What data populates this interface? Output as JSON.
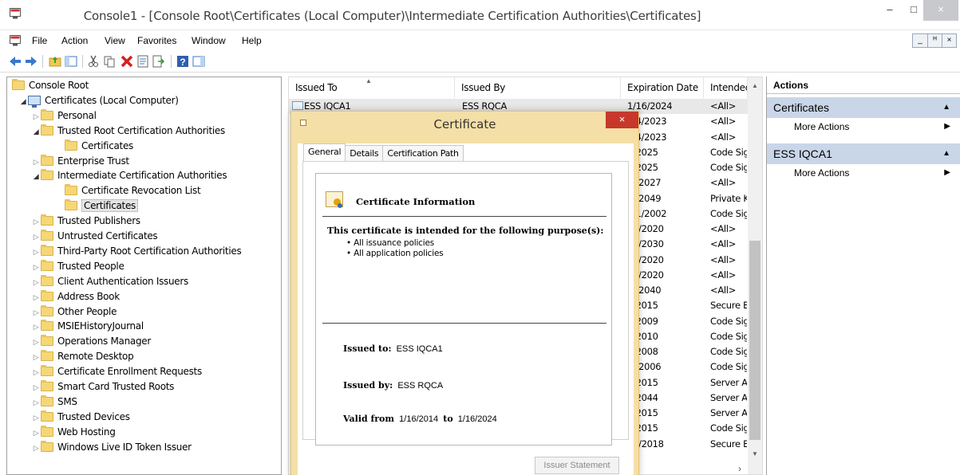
{
  "window": {
    "title": "Console1 - [Console Root\\Certificates (Local Computer)\\Intermediate Certification Authorities\\Certificates]",
    "min_glyph": "–",
    "max_glyph": "□",
    "close_glyph": "×"
  },
  "menu": {
    "items": [
      "File",
      "Action",
      "View",
      "Favorites",
      "Window",
      "Help"
    ],
    "mdi": [
      "_",
      "ᴴ",
      "×"
    ]
  },
  "tree": [
    {
      "label": "Console Root",
      "level": 0,
      "expander": "",
      "icon": "folder"
    },
    {
      "label": "Certificates (Local Computer)",
      "level": 1,
      "expander": "◢",
      "icon": "computer"
    },
    {
      "label": "Personal",
      "level": 2,
      "expander": "▷",
      "icon": "folder"
    },
    {
      "label": "Trusted Root Certification Authorities",
      "level": 2,
      "expander": "◢",
      "icon": "folder"
    },
    {
      "label": "Certificates",
      "level": 3,
      "expander": "",
      "icon": "folder"
    },
    {
      "label": "Enterprise Trust",
      "level": 2,
      "expander": "▷",
      "icon": "folder"
    },
    {
      "label": "Intermediate Certification Authorities",
      "level": 2,
      "expander": "◢",
      "icon": "folder"
    },
    {
      "label": "Certificate Revocation List",
      "level": 3,
      "expander": "",
      "icon": "folder"
    },
    {
      "label": "Certificates",
      "level": 3,
      "expander": "",
      "icon": "folder",
      "selected": true
    },
    {
      "label": "Trusted Publishers",
      "level": 2,
      "expander": "▷",
      "icon": "folder"
    },
    {
      "label": "Untrusted Certificates",
      "level": 2,
      "expander": "▷",
      "icon": "folder"
    },
    {
      "label": "Third-Party Root Certification Authorities",
      "level": 2,
      "expander": "▷",
      "icon": "folder"
    },
    {
      "label": "Trusted People",
      "level": 2,
      "expander": "▷",
      "icon": "folder"
    },
    {
      "label": "Client Authentication Issuers",
      "level": 2,
      "expander": "▷",
      "icon": "folder"
    },
    {
      "label": "Address Book",
      "level": 2,
      "expander": "▷",
      "icon": "folder"
    },
    {
      "label": "Other People",
      "level": 2,
      "expander": "▷",
      "icon": "folder"
    },
    {
      "label": "MSIEHistoryJournal",
      "level": 2,
      "expander": "▷",
      "icon": "folder"
    },
    {
      "label": "Operations Manager",
      "level": 2,
      "expander": "▷",
      "icon": "folder"
    },
    {
      "label": "Remote Desktop",
      "level": 2,
      "expander": "▷",
      "icon": "folder"
    },
    {
      "label": "Certificate Enrollment Requests",
      "level": 2,
      "expander": "▷",
      "icon": "folder"
    },
    {
      "label": "Smart Card Trusted Roots",
      "level": 2,
      "expander": "▷",
      "icon": "folder"
    },
    {
      "label": "SMS",
      "level": 2,
      "expander": "▷",
      "icon": "folder"
    },
    {
      "label": "Trusted Devices",
      "level": 2,
      "expander": "▷",
      "icon": "folder"
    },
    {
      "label": "Web Hosting",
      "level": 2,
      "expander": "▷",
      "icon": "folder"
    },
    {
      "label": "Windows Live ID Token Issuer",
      "level": 2,
      "expander": "▷",
      "icon": "folder"
    }
  ],
  "list": {
    "columns": [
      "Issued To",
      "Issued By",
      "Expiration Date",
      "Intendec"
    ],
    "sort_glyph": "▲",
    "scroll_up": "▲",
    "scroll_down": "▼",
    "h_scroll_glyph": "›",
    "rows": [
      {
        "issued_to": "ESS IQCA1",
        "issued_by": "ESS RQCA",
        "exp": "1/16/2024",
        "purpose": "<All>"
      },
      {
        "issued_to": "",
        "issued_by": "",
        "exp": "/14/2023",
        "purpose": "<All>"
      },
      {
        "issued_to": "",
        "issued_by": "",
        "exp": "/14/2023",
        "purpose": "<All>"
      },
      {
        "issued_to": "",
        "issued_by": "",
        "exp": "3/2025",
        "purpose": "Code Sig"
      },
      {
        "issued_to": "",
        "issued_by": "",
        "exp": "3/2025",
        "purpose": "Code Sig"
      },
      {
        "issued_to": "",
        "issued_by": "",
        "exp": "/5/2027",
        "purpose": "<All>"
      },
      {
        "issued_to": "",
        "issued_by": "",
        "exp": "/1/2049",
        "purpose": "Private K"
      },
      {
        "issued_to": "",
        "issued_by": "",
        "exp": "/31/2002",
        "purpose": "Code Sig"
      },
      {
        "issued_to": "",
        "issued_by": "",
        "exp": "27/2020",
        "purpose": "<All>"
      },
      {
        "issued_to": "",
        "issued_by": "",
        "exp": "27/2030",
        "purpose": "<All>"
      },
      {
        "issued_to": "",
        "issued_by": "",
        "exp": "27/2020",
        "purpose": "<All>"
      },
      {
        "issued_to": "",
        "issued_by": "",
        "exp": "27/2020",
        "purpose": "<All>"
      },
      {
        "issued_to": "",
        "issued_by": "",
        "exp": "/1/2040",
        "purpose": "<All>"
      },
      {
        "issued_to": "",
        "issued_by": "",
        "exp": "3/2015",
        "purpose": "Secure E"
      },
      {
        "issued_to": "",
        "issued_by": "",
        "exp": "3/2009",
        "purpose": "Code Sig"
      },
      {
        "issued_to": "",
        "issued_by": "",
        "exp": "3/2010",
        "purpose": "Code Sig"
      },
      {
        "issued_to": "",
        "issued_by": "",
        "exp": "2/2008",
        "purpose": "Code Sig"
      },
      {
        "issued_to": "",
        "issued_by": "",
        "exp": "/6/2006",
        "purpose": "Code Sig"
      },
      {
        "issued_to": "",
        "issued_by": "",
        "exp": "5/2015",
        "purpose": "Server A"
      },
      {
        "issued_to": "",
        "issued_by": "",
        "exp": "5/2044",
        "purpose": "Server A"
      },
      {
        "issued_to": "",
        "issued_by": "",
        "exp": "5/2015",
        "purpose": "Server A"
      },
      {
        "issued_to": "",
        "issued_by": "",
        "exp": "5/2015",
        "purpose": "Code Sig"
      },
      {
        "issued_to": "",
        "issued_by": "",
        "exp": "20/2018",
        "purpose": "Secure E"
      }
    ]
  },
  "actions": {
    "header": "Actions",
    "sections": [
      {
        "title": "Certificates",
        "collapse_glyph": "▲",
        "items": [
          {
            "label": "More Actions",
            "glyph": "▶"
          }
        ]
      },
      {
        "title": "ESS IQCA1",
        "collapse_glyph": "▲",
        "items": [
          {
            "label": "More Actions",
            "glyph": "▶"
          }
        ]
      }
    ]
  },
  "dialog": {
    "title": "Certificate",
    "close_glyph": "×",
    "tabs": [
      "General",
      "Details",
      "Certification Path"
    ],
    "info_title": "Certificate Information",
    "purpose_heading": "This certificate is intended for the following purpose(s):",
    "policies": [
      "• All issuance policies",
      "• All application policies"
    ],
    "issued_to_label": "Issued to:",
    "issued_to_value": "ESS IQCA1",
    "issued_by_label": "Issued by:",
    "issued_by_value": "ESS RQCA",
    "valid_from_label": "Valid from",
    "valid_from": "1/16/2014",
    "valid_to_label": "to",
    "valid_to": "1/16/2024",
    "issuer_button": "Issuer Statement"
  }
}
